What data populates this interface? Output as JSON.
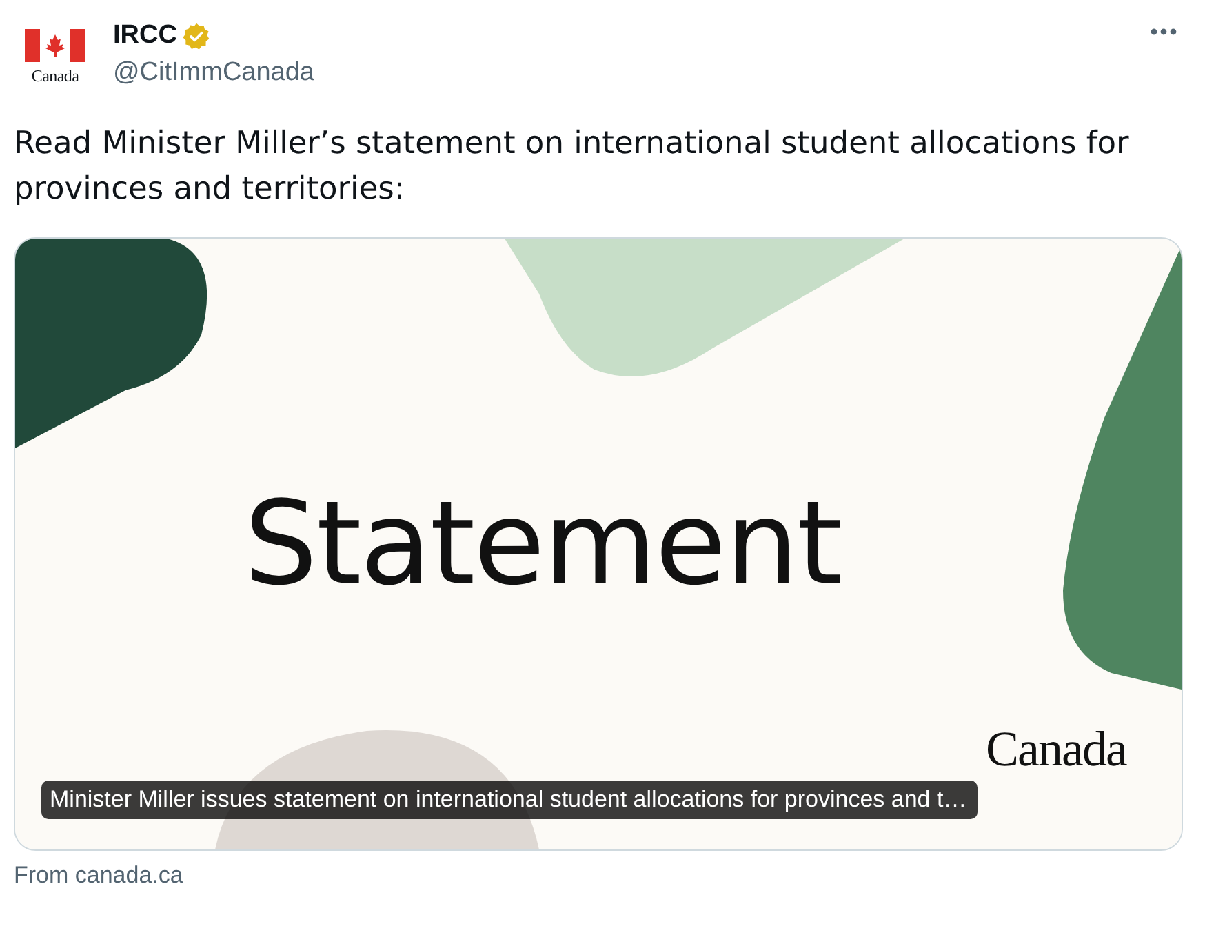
{
  "author": {
    "avatar_wordmark": "Canada",
    "name": "IRCC",
    "verified": true,
    "handle": "@CitImmCanada"
  },
  "text": "Read Minister Miller’s statement on international student allocations for provinces and territories:",
  "link_card": {
    "image_title": "Statement",
    "image_wordmark": "Canada",
    "caption": "Minister Miller issues statement on international student allocations for provinces and t…",
    "source": "From canada.ca"
  }
}
